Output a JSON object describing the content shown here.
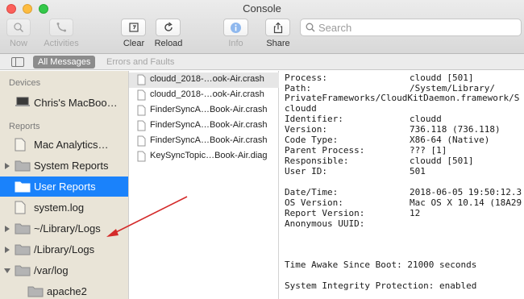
{
  "window": {
    "title": "Console"
  },
  "toolbar": {
    "now_label": "Now",
    "activities_label": "Activities",
    "clear_label": "Clear",
    "reload_label": "Reload",
    "info_label": "Info",
    "share_label": "Share"
  },
  "search": {
    "placeholder": "Search",
    "value": ""
  },
  "filters": {
    "all_messages": "All Messages",
    "errors_and_faults": "Errors and Faults"
  },
  "sidebar": {
    "devices_header": "Devices",
    "device": "Chris's MacBoo…",
    "reports_header": "Reports",
    "items": [
      {
        "label": "Mac Analytics…"
      },
      {
        "label": "System Reports"
      },
      {
        "label": "User Reports"
      },
      {
        "label": "system.log"
      },
      {
        "label": "~/Library/Logs"
      },
      {
        "label": "/Library/Logs"
      },
      {
        "label": "/var/log"
      },
      {
        "label": "apache2"
      }
    ]
  },
  "files": [
    "cloudd_2018-…ook-Air.crash",
    "cloudd_2018-…ook-Air.crash",
    "FinderSyncA…Book-Air.crash",
    "FinderSyncA…Book-Air.crash",
    "FinderSyncA…Book-Air.crash",
    "KeySyncTopic…Book-Air.diag"
  ],
  "report": {
    "process_key": "Process:",
    "process_val": "cloudd [501]",
    "path_key": "Path:",
    "path_val": "/System/Library/",
    "path_cont": "PrivateFrameworks/CloudKitDaemon.framework/S",
    "path_cont2": "cloudd",
    "identifier_key": "Identifier:",
    "identifier_val": "cloudd",
    "version_key": "Version:",
    "version_val": "736.118 (736.118)",
    "codetype_key": "Code Type:",
    "codetype_val": "X86-64 (Native)",
    "parent_key": "Parent Process:",
    "parent_val": "??? [1]",
    "responsible_key": "Responsible:",
    "responsible_val": "cloudd [501]",
    "userid_key": "User ID:",
    "userid_val": "501",
    "datetime_key": "Date/Time:",
    "datetime_val": "2018-06-05 19:50:12.3",
    "osversion_key": "OS Version:",
    "osversion_val": "Mac OS X 10.14 (18A29",
    "reportversion_key": "Report Version:",
    "reportversion_val": "12",
    "uuid_key": "Anonymous UUID:",
    "awake": "Time Awake Since Boot: 21000 seconds",
    "sip": "System Integrity Protection: enabled"
  },
  "colors": {
    "selection": "#1a82fb",
    "sidebar_bg": "#e9e4d7",
    "annotation_arrow": "#d42a2a"
  }
}
